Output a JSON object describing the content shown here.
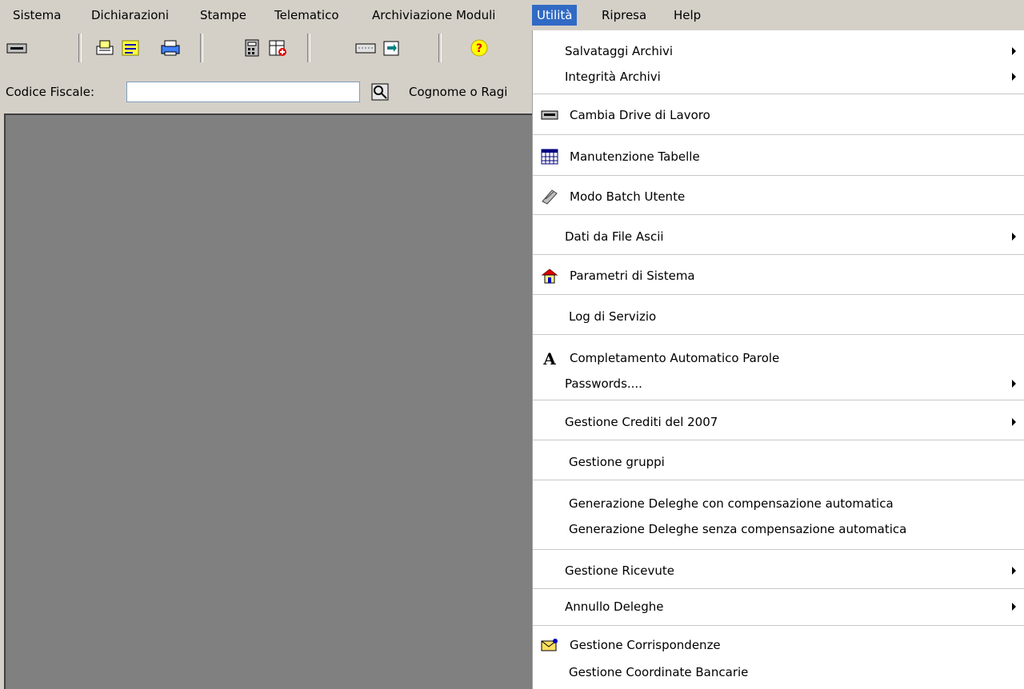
{
  "menubar": {
    "items": [
      "Sistema",
      "Dichiarazioni",
      "Stampe",
      "Telematico",
      "Archiviazione Moduli",
      "Utilità",
      "Ripresa",
      "Help"
    ],
    "active": "Utilità"
  },
  "search": {
    "codice_label": "Codice Fiscale:",
    "codice_value": "",
    "cognome_label": "Cognome o Ragi"
  },
  "icons": {
    "toolbar": [
      "drive-icon",
      "print-icon",
      "document-list-icon",
      "printer-icon",
      "calculator-icon",
      "table-plus-icon",
      "keyboard-icon",
      "folder-arrow-icon",
      "help-icon"
    ],
    "menu": [
      "drive-icon",
      "table-grid-icon",
      "batch-icon",
      "parametri-icon",
      "font-a-icon",
      "envelope-icon"
    ]
  },
  "menu": {
    "items": [
      "Salvataggi Archivi",
      "Integrità Archivi",
      "Cambia Drive di Lavoro",
      "Manutenzione Tabelle",
      "Modo Batch Utente",
      "Dati da File Ascii",
      "Parametri di Sistema",
      "Log di Servizio",
      "Completamento Automatico Parole",
      "Passwords....",
      "Gestione Crediti del 2007",
      "Gestione gruppi",
      "Generazione Deleghe con compensazione automatica",
      "Generazione Deleghe senza compensazione automatica",
      "Gestione Ricevute",
      "Annullo Deleghe",
      "Gestione Corrispondenze",
      "Gestione Coordinate Bancarie"
    ]
  },
  "colors": {
    "menu_highlight": "#316ac5",
    "workspace": "#808080",
    "chrome": "#d4d0c8"
  }
}
